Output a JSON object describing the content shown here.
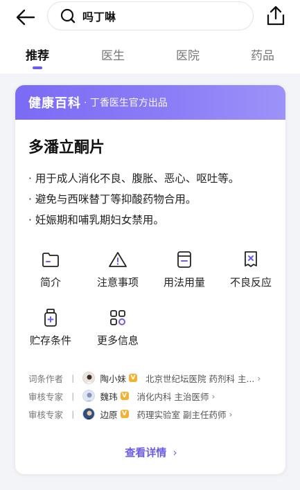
{
  "search": {
    "query": "吗丁啉"
  },
  "tabs": [
    {
      "label": "推荐"
    },
    {
      "label": "医生"
    },
    {
      "label": "医院"
    },
    {
      "label": "药品"
    }
  ],
  "card": {
    "brand": "健康百科",
    "brand_sub": "· 丁香医生官方出品",
    "title": "多潘立酮片",
    "bullets": [
      "· 用于成人消化不良、腹胀、恶心、呕吐等。",
      "· 避免与西咪替丁等抑酸药物合用。",
      "· 妊娠期和哺乳期妇女禁用。"
    ],
    "grid": [
      {
        "label": "简介",
        "icon": "folder-icon"
      },
      {
        "label": "注意事项",
        "icon": "warning-icon"
      },
      {
        "label": "用法用量",
        "icon": "dosage-icon"
      },
      {
        "label": "不良反应",
        "icon": "adverse-reaction-icon"
      },
      {
        "label": "贮存条件",
        "icon": "bottle-icon"
      },
      {
        "label": "更多信息",
        "icon": "apps-icon"
      }
    ],
    "people": [
      {
        "role": "词条作者",
        "sep": "丨",
        "name": "陶小妹",
        "badge": "V",
        "desc": "北京世纪坛医院 药剂科 主...",
        "chev": "›"
      },
      {
        "role": "审核专家",
        "sep": "丨",
        "name": "魏玮",
        "badge": "V",
        "desc": "消化内科 主治医师",
        "chev": "›"
      },
      {
        "role": "审核专家",
        "sep": "丨",
        "name": "边原",
        "badge": "V",
        "desc": "药理实验室 副主任药师",
        "chev": "›"
      }
    ],
    "more_label": "查看详情",
    "more_chev": "›"
  },
  "colors": {
    "accent": "#6b5cf0",
    "header_gradient_start": "#7b6bf5",
    "badge": "#f2b233"
  }
}
